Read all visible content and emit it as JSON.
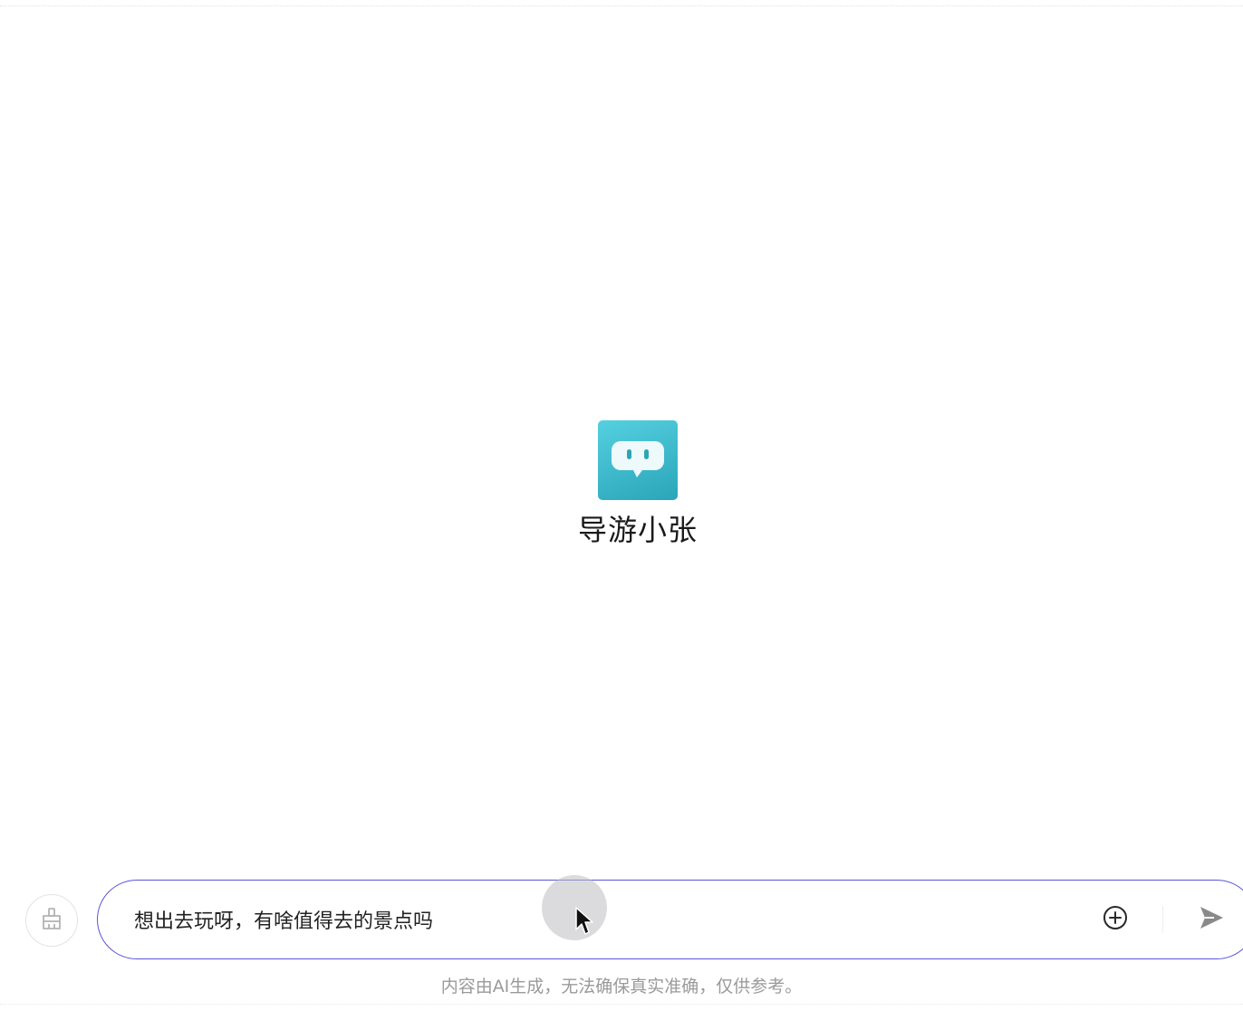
{
  "agent": {
    "name": "导游小张",
    "avatar_icon": "chat-bubble-face-icon",
    "avatar_color": "#3cbccd"
  },
  "composer": {
    "input_value": "想出去玩呀，有啥值得去的景点吗",
    "clear_icon": "broom-icon",
    "attach_icon": "plus-circle-icon",
    "send_icon": "send-icon",
    "accent": "#5a55d6"
  },
  "footer": {
    "disclaimer": "内容由AI生成，无法确保真实准确，仅供参考。"
  }
}
